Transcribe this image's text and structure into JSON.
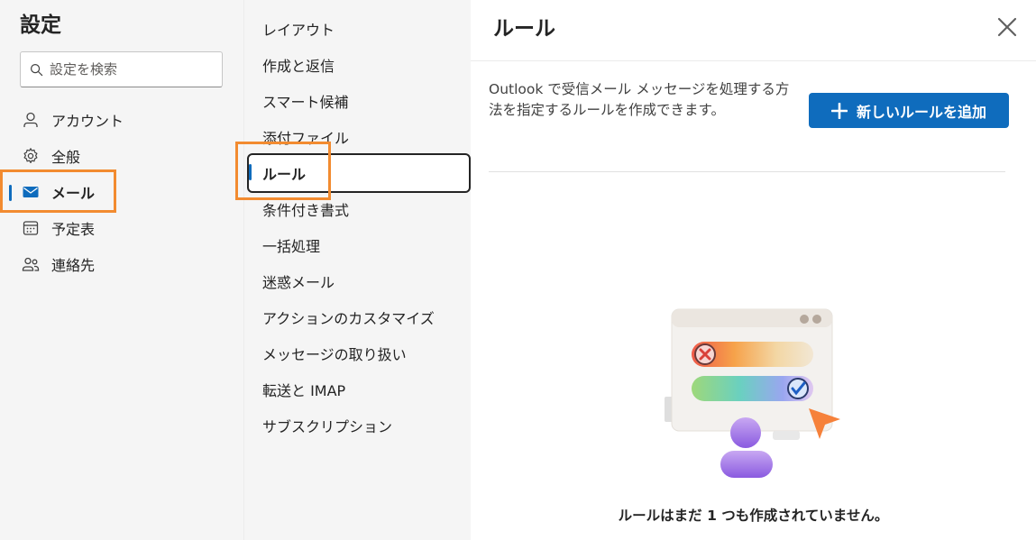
{
  "settings": {
    "title": "設定",
    "search_placeholder": "設定を検索",
    "nav": [
      {
        "label": "アカウント",
        "icon": "person-icon"
      },
      {
        "label": "全般",
        "icon": "gear-icon"
      },
      {
        "label": "メール",
        "icon": "mail-icon",
        "selected": true
      },
      {
        "label": "予定表",
        "icon": "calendar-icon"
      },
      {
        "label": "連絡先",
        "icon": "people-icon"
      }
    ]
  },
  "mail_settings": {
    "items": [
      "レイアウト",
      "作成と返信",
      "スマート候補",
      "添付ファイル",
      "ルール",
      "条件付き書式",
      "一括処理",
      "迷惑メール",
      "アクションのカスタマイズ",
      "メッセージの取り扱い",
      "転送と IMAP",
      "サブスクリプション"
    ],
    "selected_index": 4
  },
  "rules_panel": {
    "title": "ルール",
    "description": "Outlook で受信メール メッセージを処理する方法を指定するルールを作成できます。",
    "add_button_label": "新しいルールを追加",
    "empty_message": "ルールはまだ 1 つも作成されていません。"
  },
  "colors": {
    "accent": "#0f6cbd",
    "highlight": "#f28b30",
    "sidebar_bg": "#f5f5f5"
  }
}
